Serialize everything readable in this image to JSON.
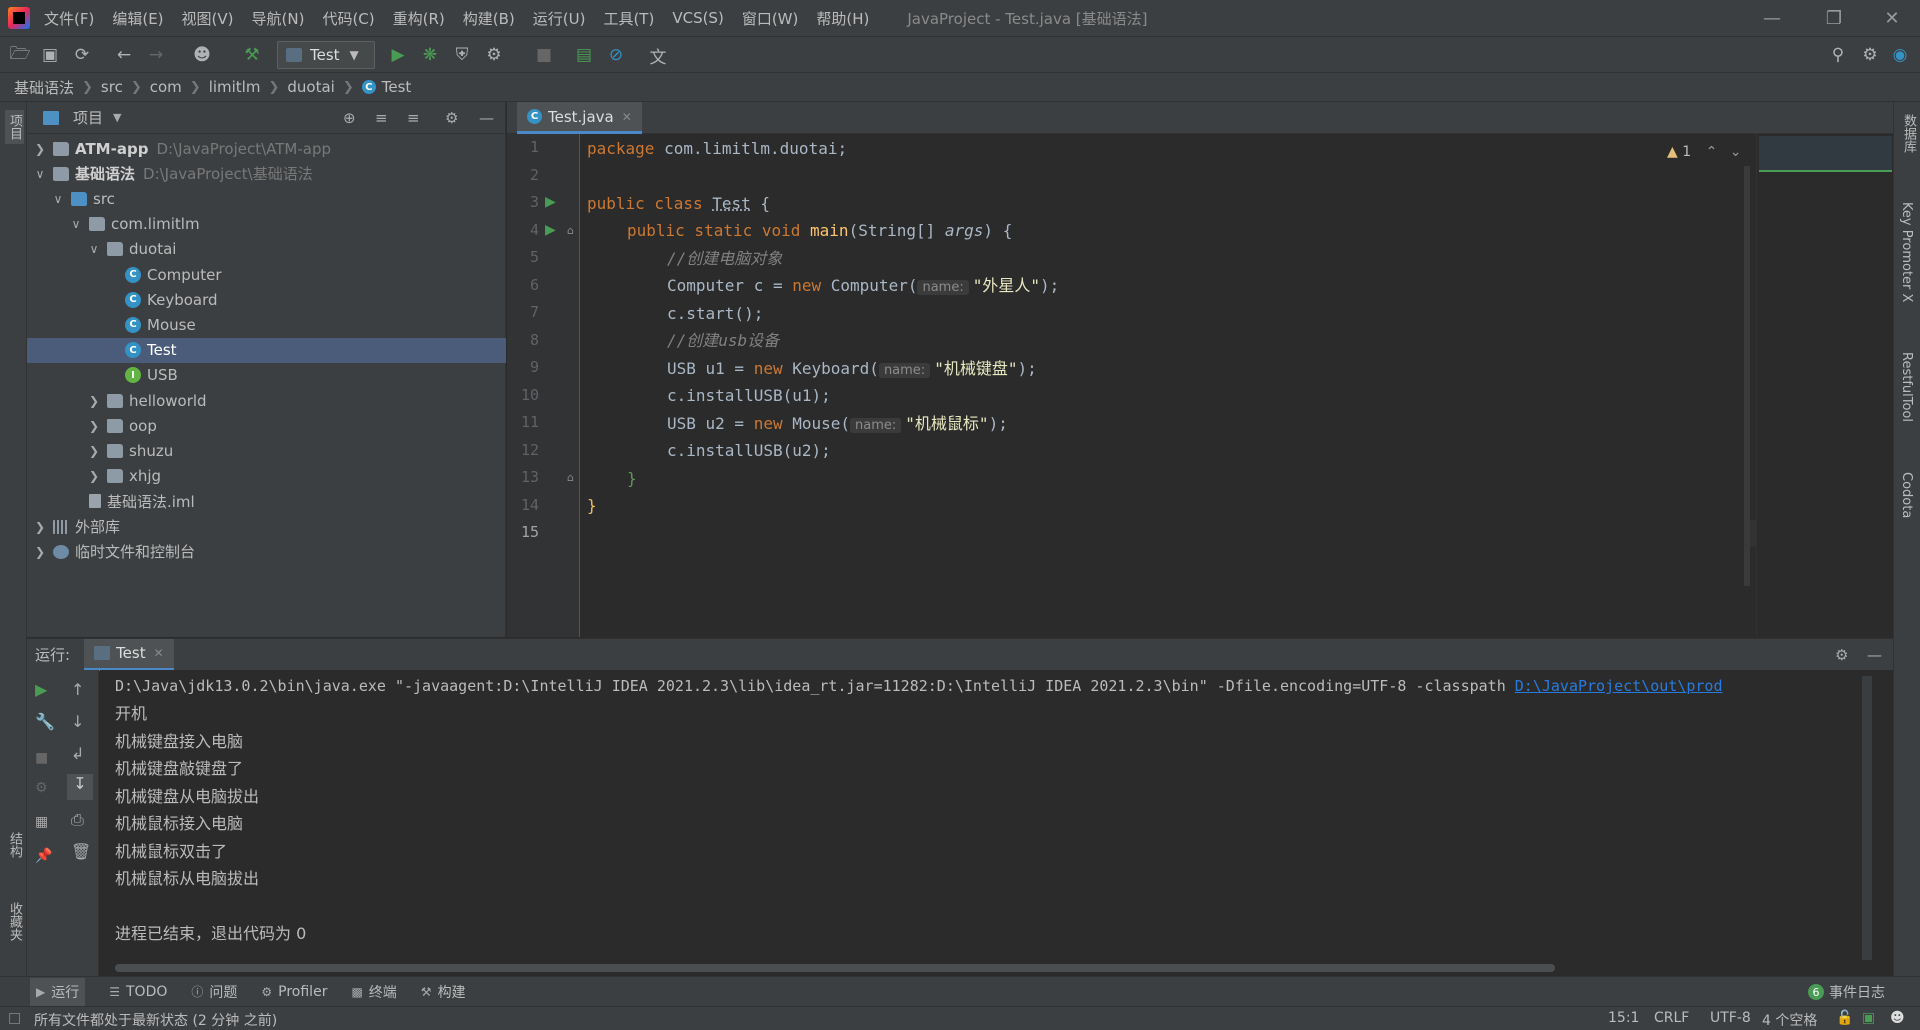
{
  "menu": [
    "文件(F)",
    "编辑(E)",
    "视图(V)",
    "导航(N)",
    "代码(C)",
    "重构(R)",
    "构建(B)",
    "运行(U)",
    "工具(T)",
    "VCS(S)",
    "窗口(W)",
    "帮助(H)"
  ],
  "window_title": "JavaProject - Test.java [基础语法]",
  "toolbar": {
    "run_config": "Test"
  },
  "breadcrumb": [
    "基础语法",
    "src",
    "com",
    "limitlm",
    "duotai",
    "Test"
  ],
  "left_stripe": {
    "project": "项目",
    "structure": "结构",
    "favorites": "收藏夹"
  },
  "right_stripe": {
    "database": "数据库",
    "key_promoter": "Key Promoter X",
    "restful": "RestfulTool",
    "codota": "Codota"
  },
  "project_panel": {
    "title": "项目",
    "tree": [
      {
        "label": "ATM-app",
        "hint": "D:\\JavaProject\\ATM-app",
        "type": "module",
        "depth": 0,
        "arrow": "right",
        "bold": true
      },
      {
        "label": "基础语法",
        "hint": "D:\\JavaProject\\基础语法",
        "type": "module",
        "depth": 0,
        "arrow": "down",
        "bold": true
      },
      {
        "label": "src",
        "hint": "",
        "type": "folder-blue",
        "depth": 1,
        "arrow": "down"
      },
      {
        "label": "com.limitlm",
        "hint": "",
        "type": "folder",
        "depth": 2,
        "arrow": "down"
      },
      {
        "label": "duotai",
        "hint": "",
        "type": "folder",
        "depth": 3,
        "arrow": "down"
      },
      {
        "label": "Computer",
        "hint": "",
        "type": "class",
        "depth": 4,
        "arrow": ""
      },
      {
        "label": "Keyboard",
        "hint": "",
        "type": "class",
        "depth": 4,
        "arrow": ""
      },
      {
        "label": "Mouse",
        "hint": "",
        "type": "class",
        "depth": 4,
        "arrow": ""
      },
      {
        "label": "Test",
        "hint": "",
        "type": "class",
        "depth": 4,
        "arrow": "",
        "selected": true
      },
      {
        "label": "USB",
        "hint": "",
        "type": "interface",
        "depth": 4,
        "arrow": ""
      },
      {
        "label": "helloworld",
        "hint": "",
        "type": "folder",
        "depth": 3,
        "arrow": "right"
      },
      {
        "label": "oop",
        "hint": "",
        "type": "folder",
        "depth": 3,
        "arrow": "right"
      },
      {
        "label": "shuzu",
        "hint": "",
        "type": "folder",
        "depth": 3,
        "arrow": "right"
      },
      {
        "label": "xhjg",
        "hint": "",
        "type": "folder",
        "depth": 3,
        "arrow": "right"
      },
      {
        "label": "基础语法.iml",
        "hint": "",
        "type": "file",
        "depth": 2,
        "arrow": ""
      },
      {
        "label": "外部库",
        "hint": "",
        "type": "lib",
        "depth": 0,
        "arrow": "right"
      },
      {
        "label": "临时文件和控制台",
        "hint": "",
        "type": "scratch",
        "depth": 0,
        "arrow": "right"
      }
    ]
  },
  "editor": {
    "tab": "Test.java",
    "warning_count": "1",
    "lines": [
      "1",
      "2",
      "3",
      "4",
      "5",
      "6",
      "7",
      "8",
      "9",
      "10",
      "11",
      "12",
      "13",
      "14",
      "15"
    ],
    "code": {
      "l1_kw": "package",
      "l1_rest": " com.limitlm.duotai;",
      "l3_kw": "public class ",
      "l3_name": "Test",
      "l3_rest": " {",
      "l4_kw": "public static void ",
      "l4_fn": "main",
      "l4_rest": "(String[] ",
      "l4_param": "args",
      "l4_end": ") {",
      "l5": "//创建电脑对象",
      "l6_a": "Computer c = ",
      "l6_kw": "new",
      "l6_b": " Computer(",
      "l6_hint": "name:",
      "l6_str": "\"外星人\"",
      "l6_end": ");",
      "l7": "c.start();",
      "l8": "//创建usb设备",
      "l9_a": "USB u1 = ",
      "l9_kw": "new",
      "l9_b": " Keyboard(",
      "l9_hint": "name:",
      "l9_str": "\"机械键盘\"",
      "l9_end": ");",
      "l10": "c.installUSB(u1);",
      "l11_a": "USB u2 = ",
      "l11_kw": "new",
      "l11_b": " Mouse(",
      "l11_hint": "name:",
      "l11_str": "\"机械鼠标\"",
      "l11_end": ");",
      "l12": "c.installUSB(u2);",
      "l13": "}",
      "l14": "}"
    }
  },
  "run_panel": {
    "label": "运行:",
    "tab": "Test",
    "command": "D:\\Java\\jdk13.0.2\\bin\\java.exe \"-javaagent:D:\\IntelliJ IDEA 2021.2.3\\lib\\idea_rt.jar=11282:D:\\IntelliJ IDEA 2021.2.3\\bin\" -Dfile.encoding=UTF-8 -classpath ",
    "classpath_link": "D:\\JavaProject\\out\\prod",
    "output": [
      "开机",
      "机械键盘接入电脑",
      "机械键盘敲键盘了",
      "机械键盘从电脑拔出",
      "机械鼠标接入电脑",
      "机械鼠标双击了",
      "机械鼠标从电脑拔出"
    ],
    "exit_message": "进程已结束，退出代码为 0"
  },
  "bottom_tabs": [
    "运行",
    "TODO",
    "问题",
    "Profiler",
    "终端",
    "构建"
  ],
  "event_log": {
    "count": "6",
    "label": "事件日志"
  },
  "status": {
    "message": "所有文件都处于最新状态 (2 分钟 之前)",
    "position": "15:1",
    "line_sep": "CRLF",
    "encoding": "UTF-8",
    "indent": "4 个空格"
  },
  "colors": {
    "accent": "#4a88c7",
    "run_green": "#499c54",
    "background": "#2b2b2b",
    "panel": "#3c3f41"
  }
}
